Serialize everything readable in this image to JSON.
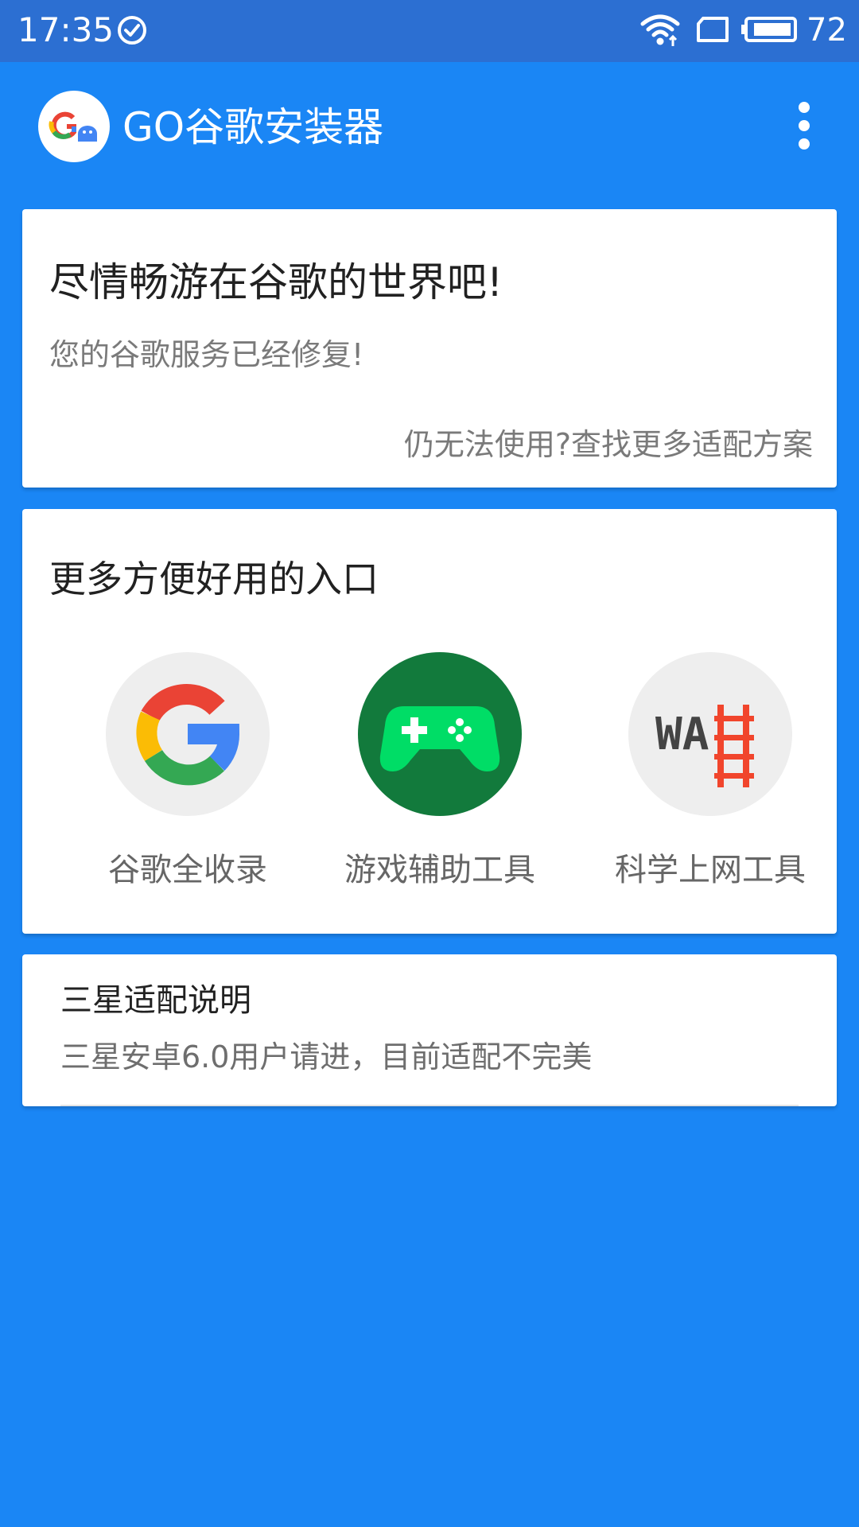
{
  "status_bar": {
    "time": "17:35",
    "battery": "72",
    "icons": [
      "check-circle-icon",
      "wifi-icon",
      "sim-card-icon",
      "battery-icon"
    ]
  },
  "app_bar": {
    "title": "GO谷歌安装器",
    "logo_icon": "go-google-logo-icon",
    "menu_icon": "more-vertical-icon"
  },
  "hero_card": {
    "title": "尽情畅游在谷歌的世界吧!",
    "subtitle": "您的谷歌服务已经修复!",
    "link": "仍无法使用?查找更多适配方案"
  },
  "entries_card": {
    "title": "更多方便好用的入口",
    "items": [
      {
        "label": "谷歌全收录",
        "icon": "google-g-icon"
      },
      {
        "label": "游戏辅助工具",
        "icon": "gamepad-icon"
      },
      {
        "label": "科学上网工具",
        "icon": "wa-ladder-icon",
        "icon_text": "WA"
      }
    ]
  },
  "notice_card": {
    "title": "三星适配说明",
    "subtitle": "三星安卓6.0用户请进，目前适配不完美"
  },
  "colors": {
    "background": "#1a86f5",
    "status_bar": "#2c6fd2",
    "game_circle": "#127a3c",
    "game_pad": "#00dd66",
    "ladder": "#f1452c"
  }
}
